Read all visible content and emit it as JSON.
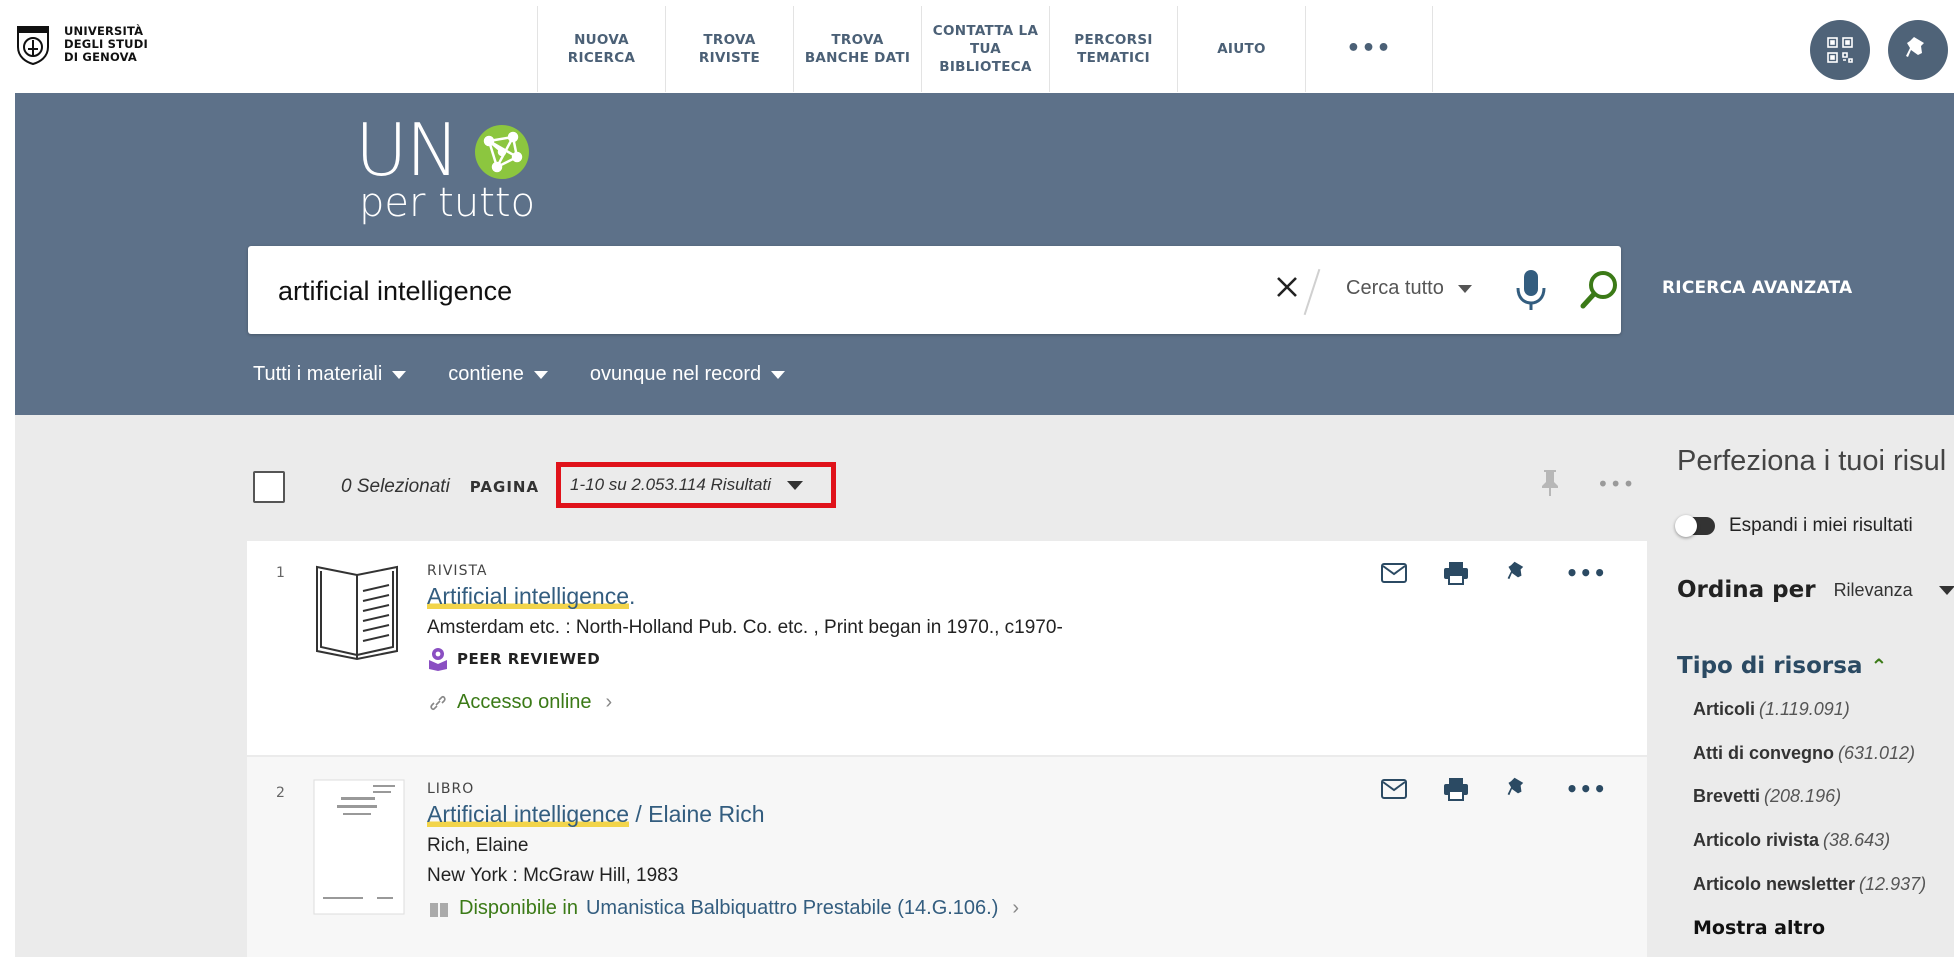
{
  "header": {
    "university_lines": [
      "UNIVERSITÀ",
      "DEGLI STUDI",
      "DI GENOVA"
    ],
    "nav": [
      {
        "label": "NUOVA\nRICERCA"
      },
      {
        "label": "TROVA\nRIVISTE"
      },
      {
        "label": "TROVA\nBANCHE DATI"
      },
      {
        "label": "CONTATTA LA\nTUA\nBIBLIOTECA"
      },
      {
        "label": "PERCORSI\nTEMATICI"
      },
      {
        "label": "AIUTO"
      },
      {
        "label": "•••"
      }
    ]
  },
  "brand": {
    "un": "UN",
    "tagline": "per tutto"
  },
  "search": {
    "query": "artificial intelligence",
    "scope": "Cerca tutto",
    "advanced": "RICERCA AVANZATA",
    "filters": [
      "Tutti i materiali",
      "contiene",
      "ovunque nel record"
    ]
  },
  "toolbar": {
    "selected": "0 Selezionati",
    "page_label": "PAGINA",
    "range": "1-10 su 2.053.114 Risultati",
    "more": "•••"
  },
  "results": [
    {
      "num": "1",
      "type": "RIVISTA",
      "title_hl": "Artificial intelligence",
      "title_rest": ".",
      "lines": [
        "Amsterdam etc. : North-Holland Pub. Co. etc. , Print began in 1970., c1970-"
      ],
      "badge": "PEER REVIEWED",
      "access": "Accesso online"
    },
    {
      "num": "2",
      "type": "LIBRO",
      "title_hl": "Artificial intelligence",
      "title_rest": " / Elaine Rich",
      "lines": [
        "Rich, Elaine",
        "New York : McGraw Hill, 1983"
      ],
      "avail_status": "Disponibile in",
      "avail_location": "Umanistica Balbiquattro  Prestabile (14.G.106.)"
    }
  ],
  "actions_more": "•••",
  "panel": {
    "title": "Perfeziona i tuoi risul",
    "expand": "Espandi i miei risultati",
    "order_label": "Ordina per",
    "order_value": "Rilevanza",
    "facet_title": "Tipo di risorsa",
    "facets": [
      {
        "label": "Articoli",
        "count": "(1.119.091)"
      },
      {
        "label": "Atti di convegno",
        "count": "(631.012)"
      },
      {
        "label": "Brevetti",
        "count": "(208.196)"
      },
      {
        "label": "Articolo rivista",
        "count": "(38.643)"
      },
      {
        "label": "Articolo newsletter",
        "count": "(12.937)"
      }
    ],
    "more": "Mostra altro"
  },
  "colors": {
    "accent": "#5d7189",
    "link": "#335d7f",
    "green": "#3b7a17",
    "highlight": "#e0121a"
  }
}
